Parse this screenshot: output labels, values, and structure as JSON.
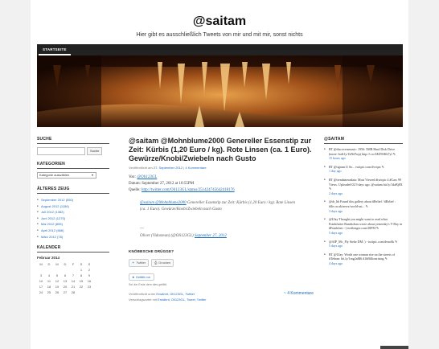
{
  "site": {
    "title": "@saitam",
    "description": "Hier gibt es ausschließlich Tweets von mir und mit mir, sonst nichts"
  },
  "nav": {
    "home": "STARTSEITE"
  },
  "sidebar": {
    "search_title": "SUCHE",
    "search_button": "Suche",
    "categories_title": "KATEGORIEN",
    "categories_select": "Kategorie auswählen",
    "archive_title": "ÄLTERES ZEUG",
    "archive": [
      "September 2012 (550)",
      "August 2012 (1156)",
      "Juli 2012 (1382)",
      "Juni 2012 (1275)",
      "Mai 2012 (855)",
      "April 2012 (666)",
      "März 2012 (78)"
    ],
    "calendar_title": "KALENDER",
    "calendar_month": "Februar 2014",
    "calendar_days": [
      "M",
      "D",
      "M",
      "D",
      "F",
      "S",
      "S"
    ],
    "calendar_rows": [
      [
        "",
        "",
        "",
        "",
        "",
        "1",
        "2"
      ],
      [
        "3",
        "4",
        "5",
        "6",
        "7",
        "8",
        "9"
      ],
      [
        "10",
        "11",
        "12",
        "13",
        "14",
        "15",
        "16"
      ],
      [
        "17",
        "18",
        "19",
        "20",
        "21",
        "22",
        "23"
      ],
      [
        "24",
        "25",
        "26",
        "27",
        "28",
        "",
        ""
      ]
    ]
  },
  "post": {
    "title": "@saitam @Mohnblume2000 Genereller Essenstip zur Zeit: Kürbis (1,20 Euro / kg). Rote Linsen (ca. 1 Euro). Gewürze/Knobi/Zwiebeln nach Gusto",
    "meta_prefix": "Veröffentlicht am",
    "meta_date": "27. September 2012",
    "meta_sep": "|",
    "meta_comments": "4 Kommentare",
    "via_label": "Von:",
    "via_user": "@Oli123GL",
    "date_line": "Datum: September 27, 2012 at 10:55PM",
    "source_label": "Quelle:",
    "source_url": "http://twitter.com/Oli123GL/status/251424745642418176",
    "quote_mentions": "@saitam @Mohnblume2000",
    "quote_text": "Genereller Essenstip zur Zeit: Kürbis (1,20 Euro / kg). Rote Linsen (ca. 1 Euro). Gewürze/Knobi/Zwiebeln nach Gusto",
    "quote_author": "Oliver (Vidoxtean) (@Oli123GL)",
    "quote_date": "September 27, 2012",
    "dash": "—",
    "share_title": "KNÖBBSCHE DRÜGGE?",
    "share_twitter": "Twitter",
    "share_print": "Drucken",
    "like_label": "Gefällt mir",
    "like_note": "Sei der Erste dem dies gefällt.",
    "posted_in_prefix": "Veröffentlicht unter",
    "posted_in": "Erwähnt, Oli123GL, Twitter",
    "tags_prefix": "Verschlagwortet mit",
    "tags": "Erwähnt, Oli123GL, Tweet, Twitter",
    "comments_count": "~ 4 Kommentare"
  },
  "rightbar": {
    "title": "@SAITAM",
    "tweets": [
      {
        "text": "RT @discoverrmusic: 1956: 5MB Hard Disk Drive (more: buff.ly/1kNtPwp) http://t.co/4EZ9SKb7yl ✎",
        "time": "15 hours ago"
      },
      {
        "text": "RT @tigrum11 So... twitpic.com/dvvipn ✎",
        "time": "1 day ago"
      },
      {
        "text": "RT @trendsmeradata: Most Viewed #twitpic 4 #Cars 99 Views. Uploaded 02.9 days ago. @saitam bit.ly/1daBj8X ✎",
        "time": "2 days ago"
      },
      {
        "text": "@dr_bb Found this gallery about #Relief / #Relief : fdle.cn.uk/news/world-asi... ✎",
        "time": "3 days ago"
      },
      {
        "text": "@Ulay Thought you might want to read what Frankfurter Rundschau wrote about yesterday's V-Day in #Frankfurt :-) twitlonger.com/20FM ✎",
        "time": "5 days ago"
      },
      {
        "text": "@AIP_Mc_Fly Siehe DM :) - twitpic.com/dvno6k ✎",
        "time": "5 days ago"
      },
      {
        "text": "RT @Ulay: Worth one woman rise on the streets of #Tehran: bit.ly/1mg2nM6 #1bBillionrising ✎",
        "time": "4 days ago"
      }
    ]
  },
  "colors": {
    "link": "#1e6bb8",
    "nav_bg": "#222222",
    "page_bg": "#f1f1f1"
  }
}
